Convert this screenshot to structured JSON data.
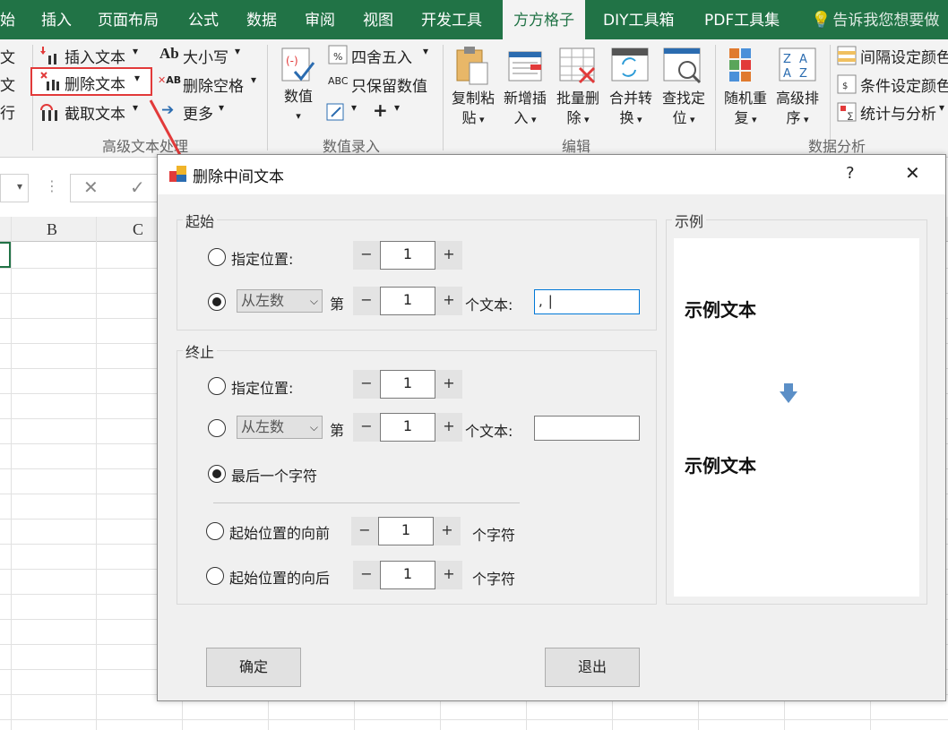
{
  "tabs": [
    "始",
    "插入",
    "页面布局",
    "公式",
    "数据",
    "审阅",
    "视图",
    "开发工具",
    "方方格子",
    "DIY工具箱",
    "PDF工具集"
  ],
  "tell_me": "告诉我您想要做",
  "ribbon": {
    "left_items": [
      "文",
      "文",
      "行"
    ],
    "text_group": {
      "insert": "插入文本",
      "delete": "删除文本",
      "extract": "截取文本",
      "case": "大小写",
      "remove_space": "删除空格",
      "more": "更多",
      "group_label": "高级文本处理"
    },
    "number_group": {
      "value_label": "数值",
      "round": "四舍五入",
      "keep_number": "只保留数值",
      "group_label": "数值录入"
    },
    "edit_group": {
      "items": [
        {
          "line1": "复制粘",
          "line2": "贴"
        },
        {
          "line1": "新增插",
          "line2": "入"
        },
        {
          "line1": "批量删",
          "line2": "除"
        },
        {
          "line1": "合并转",
          "line2": "换"
        },
        {
          "line1": "查找定",
          "line2": "位"
        }
      ],
      "group_label": "编辑"
    },
    "analysis_group": {
      "items": [
        {
          "line1": "随机重",
          "line2": "复"
        },
        {
          "line1": "高级排",
          "line2": "序"
        }
      ],
      "small": [
        "间隔设定颜色",
        "条件设定颜色",
        "统计与分析"
      ],
      "group_label": "数据分析"
    }
  },
  "sheet": {
    "columns": [
      "B",
      "C"
    ]
  },
  "dialog": {
    "title": "删除中间文本",
    "help": "?",
    "close": "✕",
    "start": {
      "legend": "起始",
      "specify_label": "指定位置:",
      "specify_value": "1",
      "direction": "从左数",
      "nth_label": "第",
      "nth_value": "1",
      "text_label": "个文本:",
      "text_value": ","
    },
    "end": {
      "legend": "终止",
      "specify_label": "指定位置:",
      "specify_value": "1",
      "direction": "从左数",
      "nth_label": "第",
      "nth_value": "1",
      "text_label": "个文本:",
      "text_value": "",
      "last_char": "最后一个字符",
      "before_label": "起始位置的向前",
      "before_value": "1",
      "after_label": "起始位置的向后",
      "after_value": "1",
      "chars_unit": "个字符"
    },
    "example": {
      "legend": "示例",
      "before": "示例文本",
      "after": "示例文本"
    },
    "ok": "确定",
    "exit": "退出",
    "selected_start": "nth-text",
    "selected_end": "last-char"
  },
  "colors": {
    "excel_green": "#217346",
    "highlight_red": "#e23a3a",
    "arrow_blue": "#5b8fc7"
  }
}
